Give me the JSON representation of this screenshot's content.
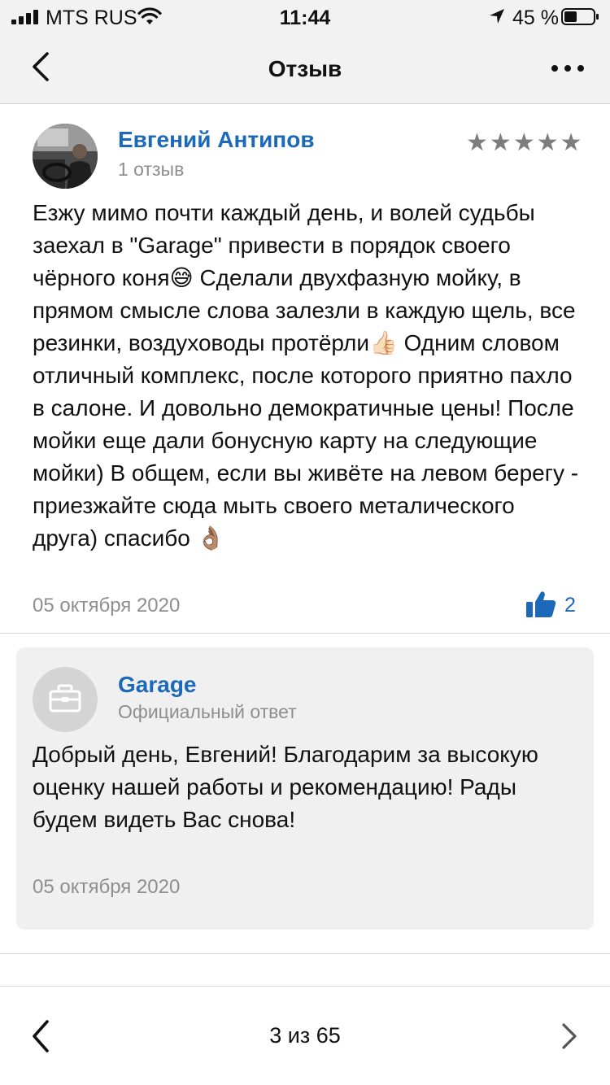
{
  "status_bar": {
    "carrier": "MTS RUS",
    "time": "11:44",
    "battery_percent": "45 %",
    "battery_level": 0.45
  },
  "nav": {
    "title": "Отзыв",
    "back_icon": "chevron-left-icon",
    "more_icon": "more-horizontal-icon"
  },
  "review": {
    "author_name": "Евгений Антипов",
    "author_review_count": "1 отзыв",
    "rating": 5,
    "stars": [
      "★",
      "★",
      "★",
      "★",
      "★"
    ],
    "text": "Езжу мимо почти каждый день, и волей судьбы заехал в \"Garage\" привести в порядок своего чёрного коня😅 Сделали двухфазную мойку, в прямом смысле слова залезли в каждую щель, все резинки, воздуховоды протёрли👍🏻 Одним словом отличный комплекс, после которого приятно пахло в салоне. И довольно демократичные цены! После мойки еще дали бонусную карту на следующие мойки) В общем, если вы живёте на левом берегу - приезжайте сюда мыть своего металического друга) спасибо 👌🏽",
    "date": "05 октября 2020",
    "likes": "2"
  },
  "reply": {
    "name": "Garage",
    "subtitle": "Официальный ответ",
    "text": "Добрый день, Евгений! Благодарим за высокую оценку нашей работы и рекомендацию! Рады будем видеть Вас снова!",
    "date": "05 октября 2020"
  },
  "pager": {
    "label": "3 из 65"
  },
  "colors": {
    "link_blue": "#1b69b8",
    "secondary_text": "#8e8e8e",
    "star_gray": "#7d7d7d",
    "card_bg": "#f0f0f0",
    "bar_bg": "#f2f2f2"
  }
}
